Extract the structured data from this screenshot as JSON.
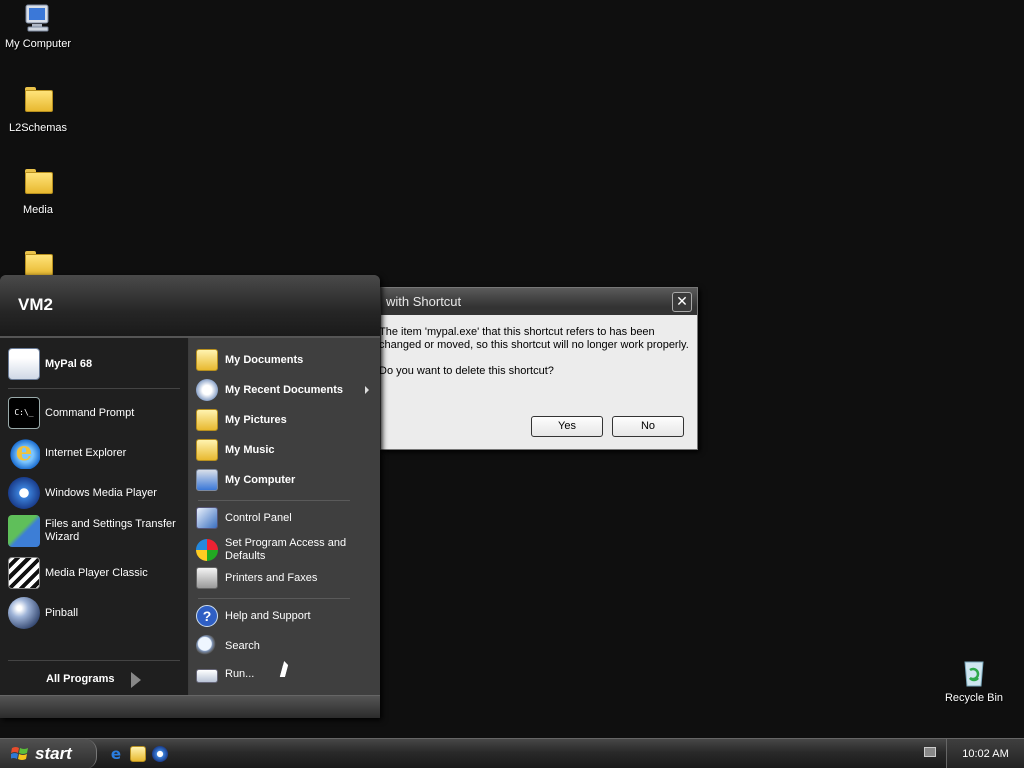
{
  "desktop": {
    "icons": [
      {
        "label": "My Computer"
      },
      {
        "label": "L2Schemas"
      },
      {
        "label": "Media"
      },
      {
        "label": ""
      },
      {
        "label": "Recycle Bin"
      }
    ]
  },
  "start_menu": {
    "user": "VM2",
    "pinned": [
      {
        "label": "MyPal 68"
      }
    ],
    "recent": [
      {
        "label": "Command Prompt"
      },
      {
        "label": "Internet Explorer"
      },
      {
        "label": "Windows Media Player"
      },
      {
        "label": "Files and Settings Transfer Wizard"
      },
      {
        "label": "Media Player Classic"
      },
      {
        "label": "Pinball"
      }
    ],
    "all_programs": "All Programs",
    "right": [
      {
        "label": "My Documents"
      },
      {
        "label": "My Recent Documents"
      },
      {
        "label": "My Pictures"
      },
      {
        "label": "My Music"
      },
      {
        "label": "My Computer"
      },
      {
        "label": "Control Panel"
      },
      {
        "label": "Set Program Access and Defaults"
      },
      {
        "label": "Printers and Faxes"
      },
      {
        "label": "Help and Support"
      },
      {
        "label": "Search"
      },
      {
        "label": "Run..."
      }
    ]
  },
  "dialog": {
    "title": "with Shortcut",
    "message": "The item 'mypal.exe' that this shortcut refers to has been changed or moved, so this shortcut will no longer work properly.",
    "question": "Do you want to delete this shortcut?",
    "yes": "Yes",
    "no": "No"
  },
  "taskbar": {
    "start_label": "start",
    "clock": "10:02 AM"
  },
  "colors": {
    "desktop_bg": "#0f0f0f",
    "folder": "#e8b930",
    "dialog_bg": "#ececec"
  }
}
